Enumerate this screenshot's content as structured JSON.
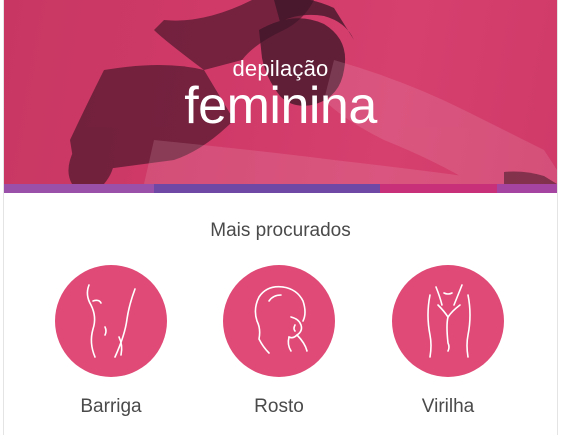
{
  "hero": {
    "subtitle": "depilação",
    "title": "feminina"
  },
  "section": {
    "title": "Mais procurados"
  },
  "cards": [
    {
      "label": "Barriga",
      "icon": "belly-icon"
    },
    {
      "label": "Rosto",
      "icon": "face-icon"
    },
    {
      "label": "Virilha",
      "icon": "groin-icon"
    }
  ],
  "colors": {
    "hero_overlay": "#cf3a69",
    "circle": "#e04a76",
    "stripe": [
      "#9a4fa8",
      "#6f47a4",
      "#c8307a",
      "#a644a2"
    ]
  }
}
